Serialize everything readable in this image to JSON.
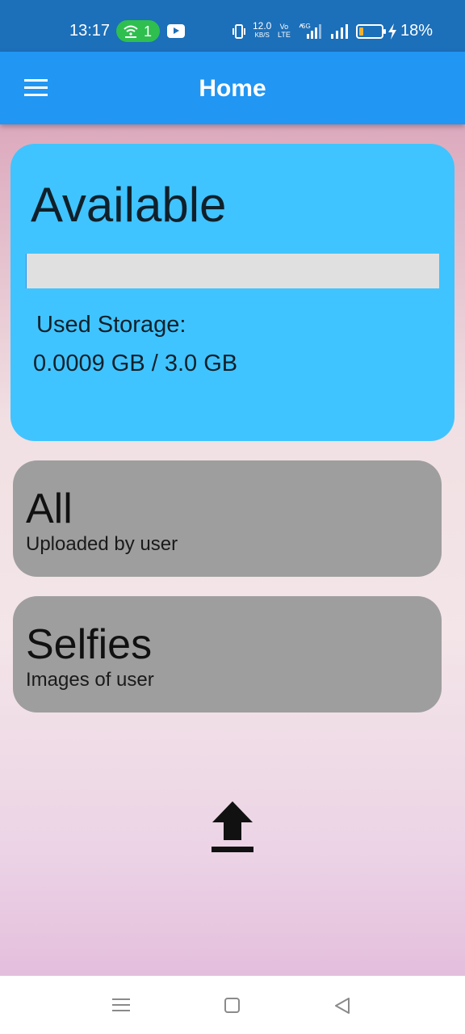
{
  "status_bar": {
    "time": "13:17",
    "hotspot_count": "1",
    "net_speed_value": "12.0",
    "net_speed_unit": "KB/S",
    "volte_top": "Vo",
    "volte_bottom": "LTE",
    "sim1_network": "5G",
    "battery_level": 0.18,
    "battery_percent": "18%",
    "icons": [
      "hotspot-icon",
      "youtube-icon",
      "vibrate-icon",
      "signal-icon",
      "battery-icon",
      "charging-icon"
    ]
  },
  "app_bar": {
    "title": "Home",
    "menu_icon": "hamburger-menu-icon"
  },
  "storage_card": {
    "title": "Available",
    "used_fraction": 0.0003,
    "used_label": "Used Storage:",
    "used_value": "0.0009 GB / 3.0 GB"
  },
  "albums": [
    {
      "title": "All",
      "subtitle": "Uploaded by user"
    },
    {
      "title": "Selfies",
      "subtitle": "Images of user"
    }
  ],
  "upload": {
    "icon": "upload-icon"
  },
  "nav_bar": {
    "icons": [
      "recent-apps-icon",
      "home-icon",
      "back-icon"
    ]
  },
  "colors": {
    "status_bar": "#1c6fb9",
    "app_bar": "#2196f3",
    "storage_card": "#40c4ff",
    "album_card": "#9e9e9e",
    "hotspot_pill": "#2ebf4f"
  }
}
